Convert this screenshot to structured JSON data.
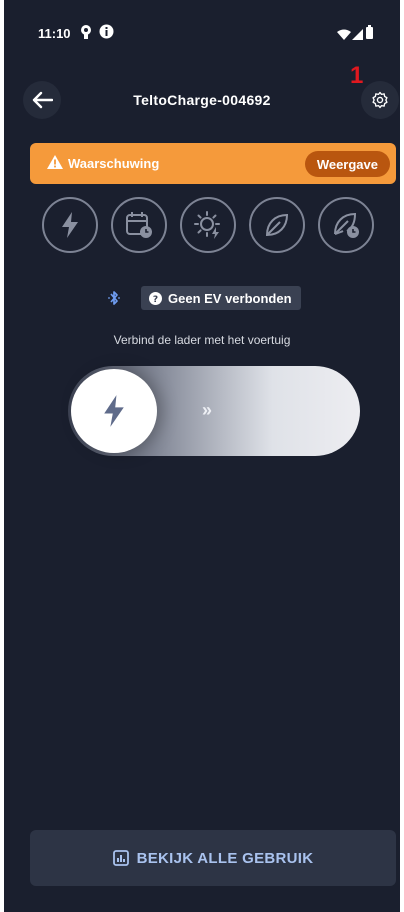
{
  "status_bar": {
    "time": "11:10",
    "icons": [
      "location-pin-icon",
      "info-badge-icon",
      "wifi-icon",
      "signal-icon",
      "battery-icon"
    ]
  },
  "header": {
    "title": "TeltoCharge-004692",
    "back_icon": "arrow-left-icon",
    "settings_icon": "gear-icon",
    "annotation": "1"
  },
  "warning": {
    "label": "Waarschuwing",
    "action_label": "Weergave",
    "color": "#f59a3b",
    "action_color": "#b9560f"
  },
  "modes": [
    {
      "name": "lightning-icon"
    },
    {
      "name": "schedule-icon"
    },
    {
      "name": "solar-icon"
    },
    {
      "name": "eco-leaf-icon"
    },
    {
      "name": "eco-leaf-plus-icon"
    }
  ],
  "connection": {
    "bluetooth_icon": "bluetooth-icon",
    "status": "Geen EV verbonden",
    "hint": "Verbind de lader met het voertuig"
  },
  "slider": {
    "chevrons": "››",
    "knob_icon": "lightning-icon"
  },
  "usage_button": {
    "label": "BEKIJK ALLE GEBRUIK",
    "icon": "chart-icon",
    "text_color": "#a9c2ee"
  },
  "colors": {
    "background": "#1a1f2e",
    "accent": "#f59a3b"
  }
}
